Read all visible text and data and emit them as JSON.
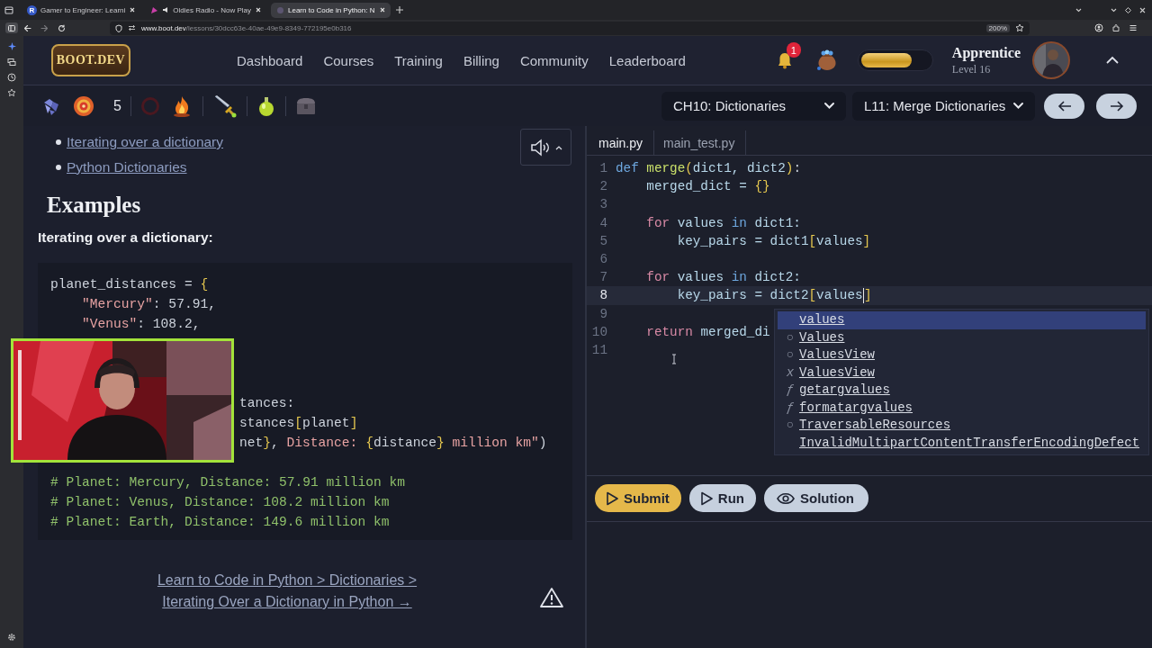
{
  "browser": {
    "tabs": [
      {
        "title": "Gamer to Engineer: Learni",
        "kind": "letter",
        "favicon_letter": "R",
        "audio": false,
        "selected": false
      },
      {
        "title": "Oldies Radio - Now Play",
        "kind": "radio",
        "audio": true,
        "selected": false
      },
      {
        "title": "Learn to Code in Python: N",
        "kind": "site",
        "audio": false,
        "selected": true
      }
    ],
    "url_host": "www.boot.dev",
    "url_path": "/lessons/30dcc63e-40ae-49e9-8349-772195e0b316",
    "zoom": "200%"
  },
  "header": {
    "logo": "BOOT.DEV",
    "nav": [
      "Dashboard",
      "Courses",
      "Training",
      "Billing",
      "Community",
      "Leaderboard"
    ],
    "notification_count": "1",
    "xp": {
      "level": 0.74
    },
    "rank": "Apprentice",
    "level_label": "Level 16",
    "avatar": {
      "kind": "picture"
    }
  },
  "subbar": {
    "inventory": [
      [
        {
          "kind": "gem"
        },
        {
          "kind": "target"
        },
        {
          "kind": "count",
          "text": "5"
        }
      ],
      [
        {
          "kind": "ring"
        },
        {
          "kind": "flame"
        }
      ],
      [
        {
          "kind": "sword"
        }
      ],
      [
        {
          "kind": "potion"
        }
      ],
      [
        {
          "kind": "chest"
        }
      ]
    ],
    "chapter": "CH10: Dictionaries",
    "lesson": "L11: Merge Dictionaries"
  },
  "lesson": {
    "links": [
      "Iterating over a dictionary",
      "Python Dictionaries"
    ],
    "heading": "Examples",
    "subheading": "Iterating over a dictionary:",
    "code": [
      {
        "kind": "code",
        "tokens": [
          {
            "text": "planet_distances = ",
            "kind": "plain"
          },
          {
            "text": "{",
            "kind": "brace"
          }
        ]
      },
      {
        "kind": "code",
        "tokens": [
          {
            "text": "    \"Mercury\"",
            "kind": "string"
          },
          {
            "text": ": 57.91,",
            "kind": "plain"
          }
        ]
      },
      {
        "kind": "code",
        "tokens": [
          {
            "text": "    \"Venus\"",
            "kind": "string"
          },
          {
            "text": ": 108.2,",
            "kind": "plain"
          }
        ]
      },
      {
        "kind": "blank"
      },
      {
        "kind": "blank"
      },
      {
        "kind": "blank"
      },
      {
        "kind": "code",
        "clipped": true,
        "tokens": [
          {
            "text": "tances:",
            "kind": "plain"
          }
        ]
      },
      {
        "kind": "code",
        "clipped": true,
        "tokens": [
          {
            "text": "stances",
            "kind": "plain"
          },
          {
            "text": "[",
            "kind": "brace"
          },
          {
            "text": "planet",
            "kind": "plain"
          },
          {
            "text": "]",
            "kind": "brace"
          }
        ]
      },
      {
        "kind": "code",
        "clipped": true,
        "tokens": [
          {
            "text": "net",
            "kind": "plain"
          },
          {
            "text": "}",
            "kind": "brace"
          },
          {
            "text": ", ",
            "kind": "plain"
          },
          {
            "text": "Distance: ",
            "kind": "string"
          },
          {
            "text": "{",
            "kind": "brace"
          },
          {
            "text": "distance",
            "kind": "plain"
          },
          {
            "text": "}",
            "kind": "brace"
          },
          {
            "text": " million km\"",
            "kind": "string"
          },
          {
            "text": ")",
            "kind": "plain"
          }
        ]
      },
      {
        "kind": "blank"
      },
      {
        "kind": "comment",
        "tokens": [
          {
            "text": "# Planet: Mercury, Distance: 57.91 million km",
            "kind": "comment"
          }
        ]
      },
      {
        "kind": "comment",
        "tokens": [
          {
            "text": "# Planet: Venus, Distance: 108.2 million km",
            "kind": "comment"
          }
        ]
      },
      {
        "kind": "comment",
        "tokens": [
          {
            "text": "# Planet: Earth, Distance: 149.6 million km",
            "kind": "comment"
          }
        ]
      }
    ],
    "webcam": {
      "kind": "picture"
    },
    "breadcrumb": [
      "Learn to Code in Python > Dictionaries >",
      "Iterating Over a Dictionary in Python →"
    ]
  },
  "editor": {
    "files": [
      {
        "name": "main.py",
        "selected": true
      },
      {
        "name": "main_test.py",
        "selected": false
      }
    ],
    "lines": [
      {
        "number": "1",
        "current": false,
        "tokens": [
          {
            "text": "def",
            "kind": "keyword"
          },
          {
            "text": " merge",
            "kind": "function"
          },
          {
            "text": "(",
            "kind": "brace"
          },
          {
            "text": "dict1, dict2",
            "kind": "name"
          },
          {
            "text": ")",
            "kind": "brace"
          },
          {
            "text": ":",
            "kind": "plain"
          }
        ]
      },
      {
        "number": "2",
        "current": false,
        "tokens": [
          {
            "text": "    merged_dict = ",
            "kind": "name"
          },
          {
            "text": "{}",
            "kind": "brace"
          }
        ]
      },
      {
        "number": "3",
        "current": false
      },
      {
        "number": "4",
        "current": false,
        "tokens": [
          {
            "text": "    for",
            "kind": "control"
          },
          {
            "text": " values ",
            "kind": "name"
          },
          {
            "text": "in",
            "kind": "keyword"
          },
          {
            "text": " dict1:",
            "kind": "name"
          }
        ]
      },
      {
        "number": "5",
        "current": false,
        "tokens": [
          {
            "text": "        key_pairs = dict1",
            "kind": "name"
          },
          {
            "text": "[",
            "kind": "brace"
          },
          {
            "text": "values",
            "kind": "name"
          },
          {
            "text": "]",
            "kind": "brace"
          }
        ]
      },
      {
        "number": "6",
        "current": false
      },
      {
        "number": "7",
        "current": false,
        "tokens": [
          {
            "text": "    for",
            "kind": "control"
          },
          {
            "text": " values ",
            "kind": "name"
          },
          {
            "text": "in",
            "kind": "keyword"
          },
          {
            "text": " dict2:",
            "kind": "name"
          }
        ]
      },
      {
        "number": "8",
        "current": true,
        "tokens": [
          {
            "text": "        key_pairs = dict2",
            "kind": "name"
          },
          {
            "text": "[",
            "kind": "brace"
          },
          {
            "text": "values",
            "kind": "name"
          },
          {
            "text": "]",
            "kind": "brace"
          }
        ]
      },
      {
        "number": "9",
        "current": false
      },
      {
        "number": "10",
        "current": false,
        "tokens": [
          {
            "text": "    return",
            "kind": "control"
          },
          {
            "text": " merged_di",
            "kind": "name"
          }
        ]
      },
      {
        "number": "11",
        "current": false
      }
    ],
    "suggestions": [
      {
        "label": "values",
        "selected": true
      },
      {
        "label": "Values",
        "icon": "○",
        "selected": false
      },
      {
        "label": "ValuesView",
        "icon": "○",
        "selected": false
      },
      {
        "label": "ValuesView",
        "icon": "x",
        "selected": false
      },
      {
        "label": "getargvalues",
        "icon": "ƒ",
        "selected": false
      },
      {
        "label": "formatargvalues",
        "icon": "ƒ",
        "selected": false
      },
      {
        "label": "TraversableResources",
        "icon": "○",
        "selected": false
      },
      {
        "label": "InvalidMultipartContentTransferEncodingDefect",
        "selected": false
      }
    ],
    "buttons": [
      {
        "label": "Submit",
        "kind": "submit"
      },
      {
        "label": "Run",
        "kind": "run"
      },
      {
        "label": "Solution",
        "kind": "solution"
      }
    ]
  }
}
